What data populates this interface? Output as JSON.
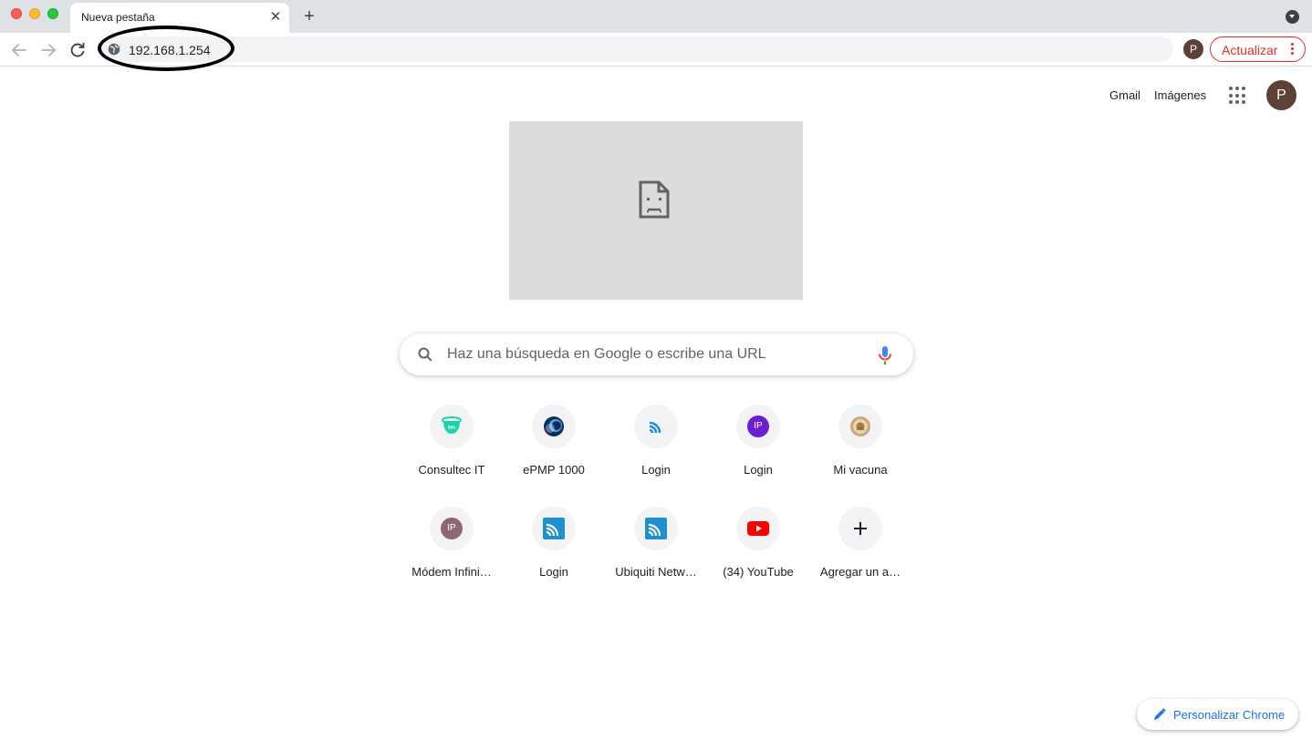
{
  "browser": {
    "tab_title": "Nueva pestaña",
    "address": "192.168.1.254",
    "profile_initial": "P",
    "update_label": "Actualizar"
  },
  "ntp": {
    "links": [
      "Gmail",
      "Imágenes"
    ],
    "avatar_initial": "P",
    "search_placeholder": "Haz una búsqueda en Google o escribe una URL",
    "shortcuts": [
      {
        "label": "Consultec IT",
        "icon": "consultec-icon"
      },
      {
        "label": "ePMP 1000",
        "icon": "cambium-icon"
      },
      {
        "label": "Login",
        "icon": "wifi-feed-icon"
      },
      {
        "label": "Login",
        "icon": "ip-badge-icon",
        "badge": "IP"
      },
      {
        "label": "Mi vacuna",
        "icon": "seal-icon"
      },
      {
        "label": "Módem Infini…",
        "icon": "ip-badge-icon",
        "badge": "IP"
      },
      {
        "label": "Login",
        "icon": "ubiquiti-icon"
      },
      {
        "label": "Ubiquiti Netw…",
        "icon": "ubiquiti-icon"
      },
      {
        "label": "(34) YouTube",
        "icon": "youtube-icon"
      },
      {
        "label": "Agregar un a…",
        "icon": "plus-icon"
      }
    ],
    "customize_label": "Personalizar Chrome"
  },
  "colors": {
    "accent_blue": "#1a73e8",
    "update_red": "#d93025",
    "avatar_brown": "#5d4037",
    "ip_purple": "#6a1fd1",
    "ip_mauve": "#8e6676",
    "consultec_green": "#1dd3a7",
    "youtube_red": "#ff0000"
  }
}
